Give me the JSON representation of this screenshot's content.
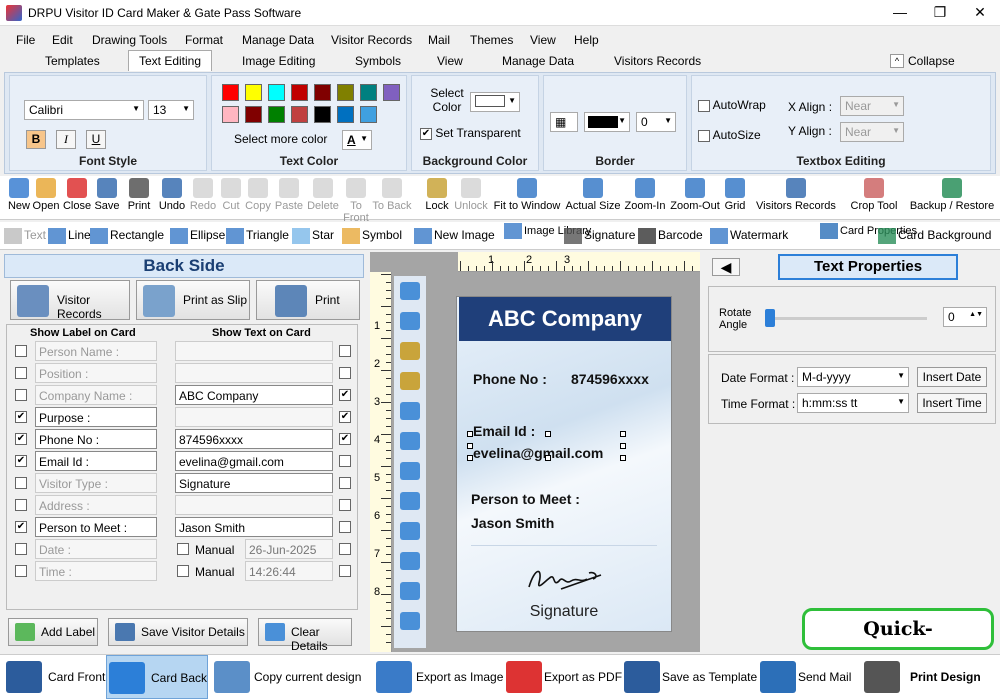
{
  "title": "DRPU Visitor ID Card Maker & Gate Pass Software",
  "window": {
    "minimize": "—",
    "restore": "❐",
    "close": "✕"
  },
  "menu": [
    "File",
    "Edit",
    "Drawing Tools",
    "Format",
    "Manage Data",
    "Visitor Records",
    "Mail",
    "Themes",
    "View",
    "Help"
  ],
  "ribbon_tabs": [
    "Templates",
    "Text Editing",
    "Image Editing",
    "Symbols",
    "View",
    "Manage Data",
    "Visitors Records"
  ],
  "collapse": "Collapse",
  "font_style": {
    "font": "Calibri",
    "size": "13",
    "bold": "B",
    "italic": "I",
    "underline": "U",
    "label": "Font Style"
  },
  "text_color": {
    "colors": [
      "#ff0000",
      "#ffff00",
      "#00ffff",
      "#c00000",
      "#800000",
      "#808000",
      "#008080",
      "#8060c0",
      "#ffb6c1",
      "#800000",
      "#008000",
      "#c04040",
      "#000000",
      "#0070c0",
      "#40a0e0"
    ],
    "more": "Select more color",
    "label": "Text Color",
    "a": "A"
  },
  "bg_color": {
    "select": "Select Color",
    "transparent": "Set Transparent",
    "label": "Background Color"
  },
  "border": {
    "width": "0",
    "label": "Border"
  },
  "textbox": {
    "autowrap": "AutoWrap",
    "autosize": "AutoSize",
    "xalign": "X Align :",
    "yalign": "Y Align :",
    "xval": "Near",
    "yval": "Near",
    "label": "Textbox Editing"
  },
  "toolbar1": [
    "New",
    "Open",
    "Close",
    "Save",
    "Print",
    "Undo",
    "Redo",
    "Cut",
    "Copy",
    "Paste",
    "Delete",
    "To Front",
    "To Back",
    "Lock",
    "Unlock",
    "Fit to Window",
    "Actual Size",
    "Zoom-In",
    "Zoom-Out",
    "Grid",
    "Visitors Records",
    "Crop Tool",
    "Backup / Restore"
  ],
  "toolbar2": [
    "Text",
    "Line",
    "Rectangle",
    "Ellipse",
    "Triangle",
    "Star",
    "Symbol",
    "New Image",
    "Image Library",
    "Signature",
    "Barcode",
    "Watermark",
    "Card Properties",
    "Card Background"
  ],
  "left": {
    "heading": "Back Side",
    "visitor_records": "Visitor Records",
    "print_slip": "Print as Slip",
    "print": "Print",
    "show_label": "Show Label on Card",
    "show_text": "Show Text on Card",
    "labels": [
      "Person Name :",
      "Position :",
      "Company Name :",
      "Purpose :",
      "Phone No :",
      "Email Id :",
      "Visitor Type :",
      "Address :",
      "Person to Meet :",
      "Date :",
      "Time :"
    ],
    "texts": [
      "",
      "",
      "ABC Company",
      "",
      "874596xxxx",
      "evelina@gmail.com",
      "Signature",
      "",
      "Jason Smith",
      "26-Jun-2025",
      "14:26:44"
    ],
    "manual": "Manual",
    "add_label": "Add Label",
    "save_details": "Save Visitor Details",
    "clear": "Clear Details"
  },
  "card": {
    "company": "ABC Company",
    "phone_label": "Phone No :",
    "phone": "874596xxxx",
    "email_label": "Email Id :",
    "email": "evelina@gmail.com",
    "meet_label": "Person to Meet :",
    "meet": "Jason Smith",
    "signature": "Signature"
  },
  "ruler_h": [
    "1",
    "2",
    "3"
  ],
  "ruler_v": [
    "1",
    "2",
    "3",
    "4",
    "5",
    "6",
    "7",
    "8"
  ],
  "right": {
    "title": "Text Properties",
    "rotate": "Rotate Angle",
    "angle": "0",
    "date_format": "Date Format :",
    "date_val": "M-d-yyyy",
    "insert_date": "Insert Date",
    "time_format": "Time Format :",
    "time_val": "h:mm:ss tt",
    "insert_time": "Insert Time"
  },
  "watermark": "Quick-Billing.com",
  "bottom": [
    "Card Front",
    "Card Back",
    "Copy current design",
    "Export as Image",
    "Export as PDF",
    "Save as Template",
    "Send Mail",
    "Print Design"
  ]
}
